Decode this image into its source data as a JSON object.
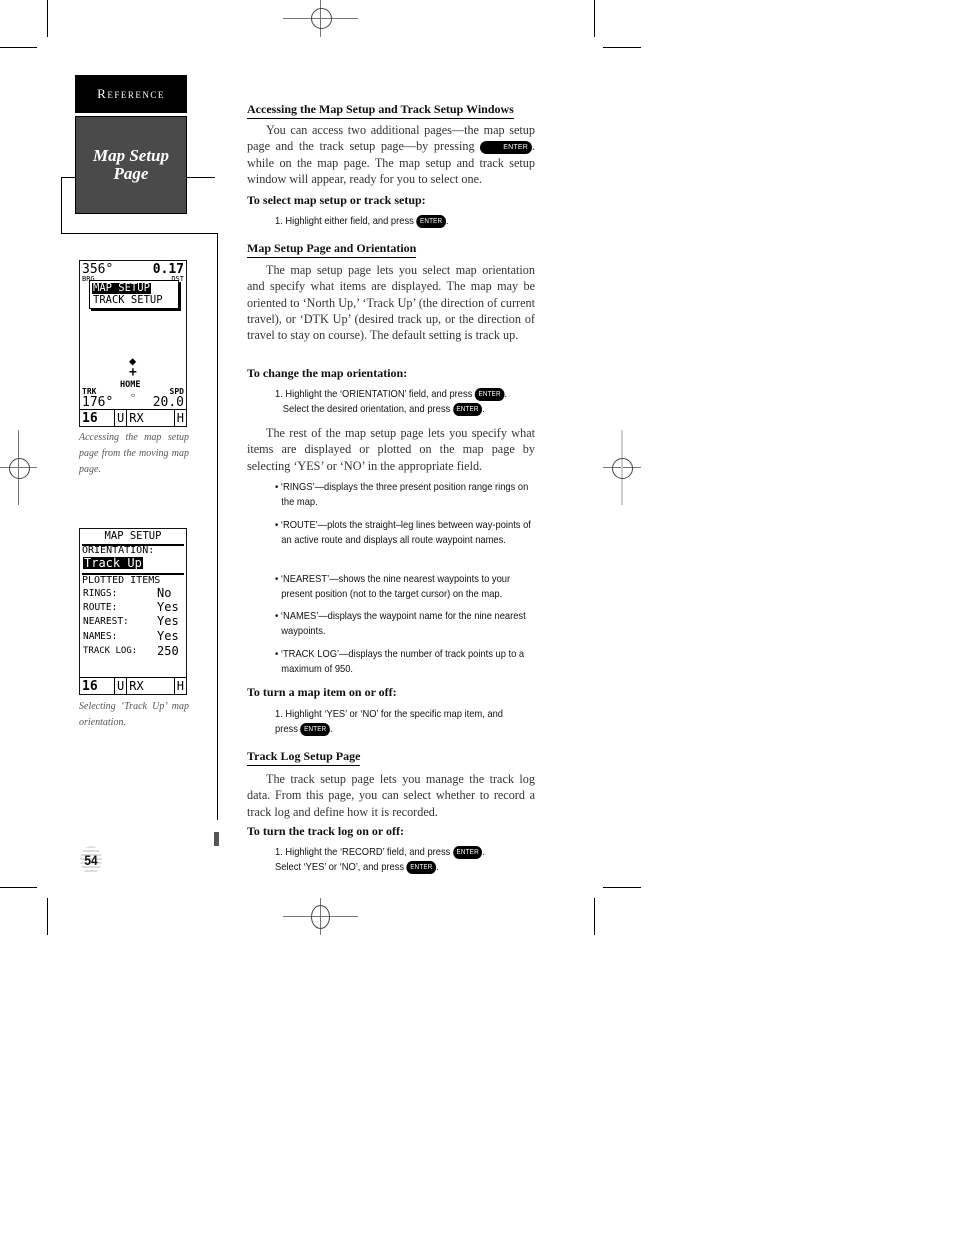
{
  "sidebar": {
    "section_tab": "Reference",
    "page_title": "Map Setup Page"
  },
  "screens": [
    {
      "name": "moving-map",
      "top_left": "356°",
      "top_left_label": "BRG",
      "top_right": "0.17",
      "top_right_label": "DST",
      "menu_items": [
        "MAP SETUP",
        "TRACK SETUP"
      ],
      "selected_menu_item": "MAP SETUP",
      "waypoint_label": "HOME",
      "bottom_left_label": "TRK",
      "bottom_left_value": "176°",
      "bottom_right_label": "SPD",
      "bottom_right_value": "20.0",
      "status": [
        "16",
        "U",
        "RX",
        "H"
      ],
      "caption": "Accessing the map setup page from the moving map page."
    },
    {
      "name": "map-setup",
      "title": "MAP SETUP",
      "orientation_label": "ORIENTATION:",
      "orientation_value": "Track Up",
      "plotted_items_label": "PLOTTED ITEMS",
      "items": [
        {
          "label": "RINGS:",
          "value": "No"
        },
        {
          "label": "ROUTE:",
          "value": "Yes"
        },
        {
          "label": "NEAREST:",
          "value": "Yes"
        },
        {
          "label": "NAMES:",
          "value": "Yes"
        },
        {
          "label": "TRACK LOG:",
          "value": "250"
        }
      ],
      "status": [
        "16",
        "U",
        "RX",
        "H"
      ],
      "caption": "Selecting ‘Track Up’ map orientation."
    }
  ],
  "key_label": "ENTER",
  "content": {
    "s1_heading": "Accessing the Map Setup and Track Setup Windows",
    "s1_para_a": "You can access two additional pages—the map setup page and the track setup page—by pressing",
    "s1_para_b": ". while on the map page. The map setup and track setup window will appear, ready for you to select one.",
    "s1_sub": "To select map setup or track setup:",
    "s1_step_a": "1. Highlight either field, and press",
    "s2_heading": "Map Setup Page and Orientation",
    "s2_para": "The map setup page lets you select map orientation and specify what items are displayed. The map may be oriented to ‘North Up,’ ‘Track Up’ (the direction of current travel), or ‘DTK Up’ (desired track up, or the direction of travel to stay on course). The default setting is track up.",
    "s2_sub": "To change the map orientation:",
    "s2_step_a": "1. Highlight the ‘ORIENTATION’ field, and press",
    "s2_step_b": "Select the desired orientation, and press",
    "s2_para2": "The rest of the map setup page lets you specify what items are displayed or plotted on the map page by selecting ‘YES’ or ‘NO’ in the appropriate field.",
    "bullets": [
      "• ‘RINGS’—displays the three present position range rings on the map.",
      "• ‘ROUTE’—plots the straight–leg lines between way-points of an active route and displays all route waypoint names.",
      "• ‘NEAREST’—shows the nine nearest waypoints to your present position (not to the target cursor) on the map.",
      "• ‘NAMES’—displays the waypoint name for the nine nearest waypoints.",
      "• ‘TRACK LOG’—displays the number of track points up to a maximum of 950."
    ],
    "s2_sub2": "To turn a map item on or off:",
    "s2_step2_a": "1. Highlight ‘YES’ or ‘NO’ for the specific map item, and press",
    "s3_heading": "Track Log Setup Page",
    "s3_para": "The track setup page lets you manage the track log data. From this page, you can select whether to record a track log and define how it is recorded.",
    "s3_sub": "To turn the track log on or off:",
    "s3_step_a": "1. Highlight the ‘RECORD’ field, and press",
    "s3_step_b": ". Select ‘YES’ or ‘NO’, and press"
  },
  "page_number": "54"
}
